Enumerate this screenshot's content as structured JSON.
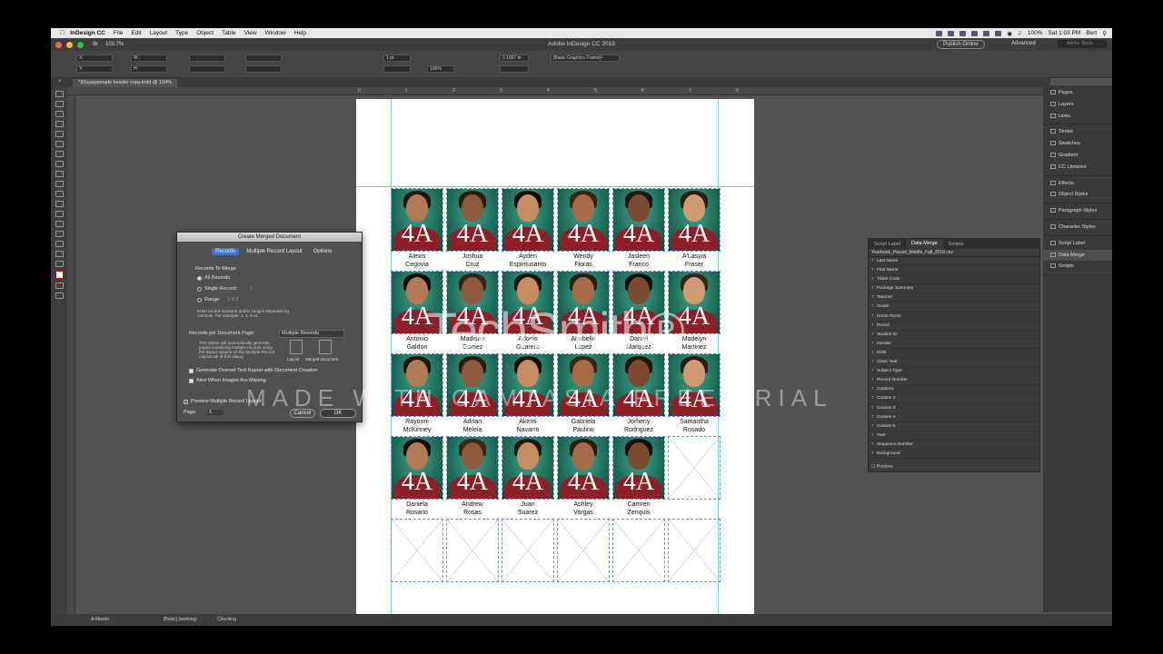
{
  "menubar": {
    "app": "InDesign CC",
    "items": [
      "File",
      "Edit",
      "Layout",
      "Type",
      "Object",
      "Table",
      "View",
      "Window",
      "Help"
    ],
    "battery": "100%",
    "clock": "Sat 1:03 PM",
    "user": "Bert"
  },
  "titlebar": {
    "title": "Adobe InDesign CC 2019",
    "publish": "Publish Online",
    "workspace": "Advanced",
    "search": "Adobe Stock"
  },
  "control": {
    "zoom": "103.7%",
    "stroke": "1 pt",
    "zoom2": "100%",
    "value": "0.1667 in",
    "style": "[Basic Graphics Frame]+"
  },
  "doc": {
    "tab": "*30upappeople header copy.indd @ 104%"
  },
  "ruler": {
    "ticks": [
      "0",
      "1",
      "2",
      "3",
      "4",
      "5",
      "6",
      "7",
      "8"
    ]
  },
  "grade_label": "4A",
  "students": [
    {
      "first": "Alexis",
      "last": "Cegovia"
    },
    {
      "first": "Joshua",
      "last": "Cruz"
    },
    {
      "first": "Ayden",
      "last": "Espiritusanto"
    },
    {
      "first": "Wendy",
      "last": "Floras"
    },
    {
      "first": "Jasleen",
      "last": "Franco"
    },
    {
      "first": "A'Lasyia",
      "last": "Fraser"
    },
    {
      "first": "Antonio",
      "last": "Galdon"
    },
    {
      "first": "Madison",
      "last": "Gomez"
    },
    {
      "first": "Adonis",
      "last": "Guarero"
    },
    {
      "first": "Anabelle",
      "last": "Lopez"
    },
    {
      "first": "Daniel",
      "last": "Marquez"
    },
    {
      "first": "Madelyn",
      "last": "Martinez"
    },
    {
      "first": "Rayonni",
      "last": "McKinney"
    },
    {
      "first": "Adrian",
      "last": "Meleia"
    },
    {
      "first": "Akemi",
      "last": "Navarro"
    },
    {
      "first": "Gabriela",
      "last": "Paulino"
    },
    {
      "first": "Jorheny",
      "last": "Rodriguez"
    },
    {
      "first": "Samantha",
      "last": "Rosado"
    },
    {
      "first": "Daniela",
      "last": "Rosario"
    },
    {
      "first": "Andrew",
      "last": "Rosas"
    },
    {
      "first": "Juan",
      "last": "Suarez"
    },
    {
      "first": "Ashley",
      "last": "Vargas"
    },
    {
      "first": "Camren",
      "last": "Zenquis"
    }
  ],
  "dialog": {
    "title": "Create Merged Document",
    "tabs": [
      "Records",
      "Multiple Record Layout",
      "Options"
    ],
    "records_to_merge": "Records To Merge",
    "all_records": "All Records",
    "single_record": "Single Record:",
    "single_value": "1",
    "range": "Range:",
    "range_value": "1-4,6",
    "info": "Enter record numbers and/or ranges separated by commas. For example: 1, 4, 6-11",
    "per_page_label": "Records per Document Page:",
    "per_page_value": "Multiple Records",
    "auto_info": "This option will automatically generate pages containing multiple records using the layout options on the Multiple Record Layout tab of this dialog.",
    "layout": "Layout",
    "merged": "Merged document",
    "overset": "Generate Overset Text Report with Document Creation",
    "missing": "Alert When Images Are Missing",
    "preview": "Preview Multiple Record Layout",
    "page_label": "Page:",
    "page_value": "1",
    "cancel": "Cancel",
    "ok": "OK"
  },
  "dataMerge": {
    "tabs": [
      "Script Label",
      "Data Merge",
      "Scripts"
    ],
    "file": "Yearbook_Passel_Middle_Fall_2018.csv",
    "fields": [
      "Last Name",
      "First Name",
      "Ticket Code",
      "Package Summary",
      "Teacher",
      "Grade",
      "Home Room",
      "Period",
      "Student ID",
      "Gender",
      "DOB",
      "Class Year",
      "Subject Type",
      "Record Number",
      "Custom1",
      "Custom 2",
      "Custom 3",
      "Custom 4",
      "Custom 5",
      "Year",
      "Sequence Number",
      "Background"
    ],
    "preview": "Preview"
  },
  "panels": [
    {
      "group": [
        "Pages",
        "Layers",
        "Links"
      ]
    },
    {
      "group": [
        "Stroke",
        "Swatches",
        "Gradient",
        "CC Libraries"
      ]
    },
    {
      "group": [
        "Effects",
        "Object Styles"
      ]
    },
    {
      "group": [
        "Paragraph Styles"
      ]
    },
    {
      "group": [
        "Character Styles"
      ]
    },
    {
      "group": [
        "Script Label",
        "Data Merge",
        "Scripts"
      ]
    }
  ],
  "status": {
    "master": "A-Master",
    "style": "[Basic] (working)",
    "preflight": "Checking"
  },
  "watermark": {
    "brand": "TechSmith®",
    "text": "MADE WITH CAMTASIA FREE TRIAL"
  },
  "colors": {
    "accent": "#3b76c9",
    "background": "#535353",
    "photo_bg": "#1f6e5c",
    "shirt": "#8e1f28"
  }
}
